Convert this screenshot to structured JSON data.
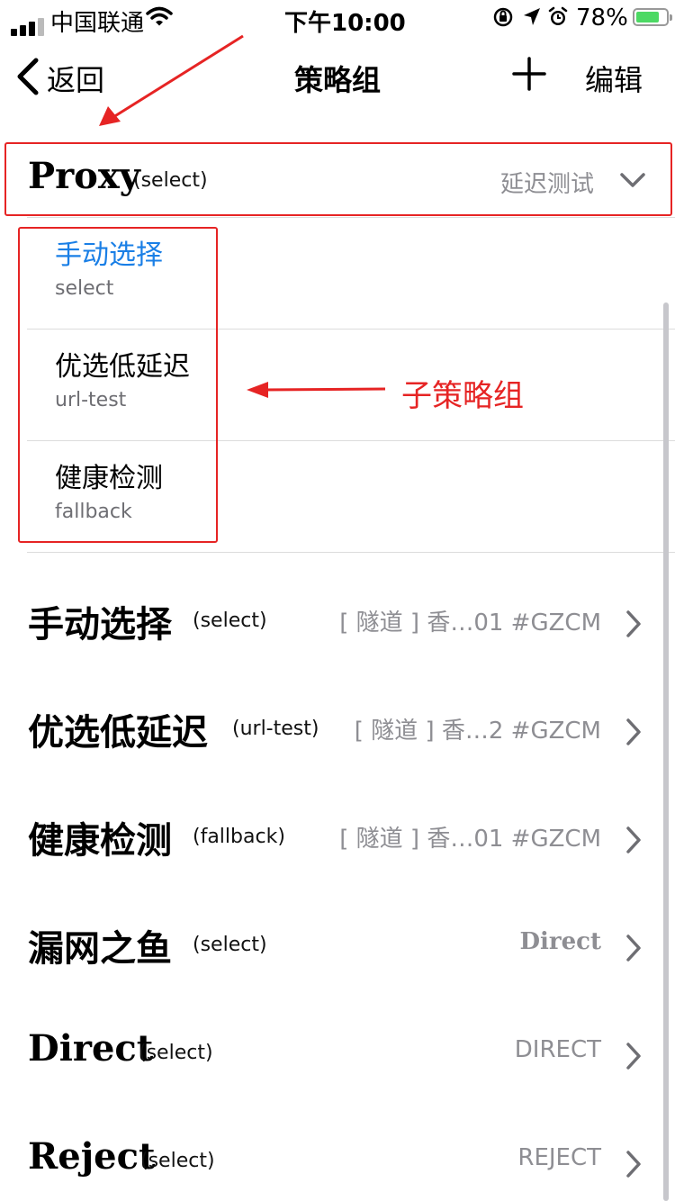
{
  "status_bar": {
    "carrier": "中国联通",
    "time": "下午10:00",
    "battery_percent": "78%",
    "battery_level": 0.78,
    "icons": [
      "signal-icon",
      "wifi-icon",
      "rotation-lock-icon",
      "location-icon",
      "alarm-icon",
      "battery-charging-icon"
    ]
  },
  "nav": {
    "back_label": "返回",
    "title": "策略组",
    "add_icon": "plus-icon",
    "edit_label": "编辑"
  },
  "proxy": {
    "name": "Proxy",
    "type": "(select)",
    "action": "延迟测试",
    "expand_icon": "chevron-down-icon"
  },
  "sub_groups": [
    {
      "title": "手动选择",
      "subtitle": "select",
      "selected": true
    },
    {
      "title": "优选低延迟",
      "subtitle": "url-test",
      "selected": false
    },
    {
      "title": "健康检测",
      "subtitle": "fallback",
      "selected": false
    }
  ],
  "annotation": {
    "label": "子策略组",
    "color": "#e62424"
  },
  "groups": [
    {
      "name": "手动选择",
      "type": "(select)",
      "value": "[ 隧道 ] 香…01 #GZCM"
    },
    {
      "name": "优选低延迟",
      "type": "(url-test)",
      "value": "[ 隧道 ] 香…2  #GZCM"
    },
    {
      "name": "健康检测",
      "type": "(fallback)",
      "value": "[ 隧道 ] 香…01 #GZCM"
    },
    {
      "name": "漏网之鱼",
      "type": "(select)",
      "value": "Direct"
    },
    {
      "name": "Direct",
      "type": "(select)",
      "value": "DIRECT"
    },
    {
      "name": "Reject",
      "type": "(select)",
      "value": "REJECT"
    }
  ],
  "colors": {
    "accent_blue": "#1a7fe6",
    "annotation_red": "#e62424",
    "secondary_text": "#8e8e93",
    "battery_green": "#4cd964"
  }
}
